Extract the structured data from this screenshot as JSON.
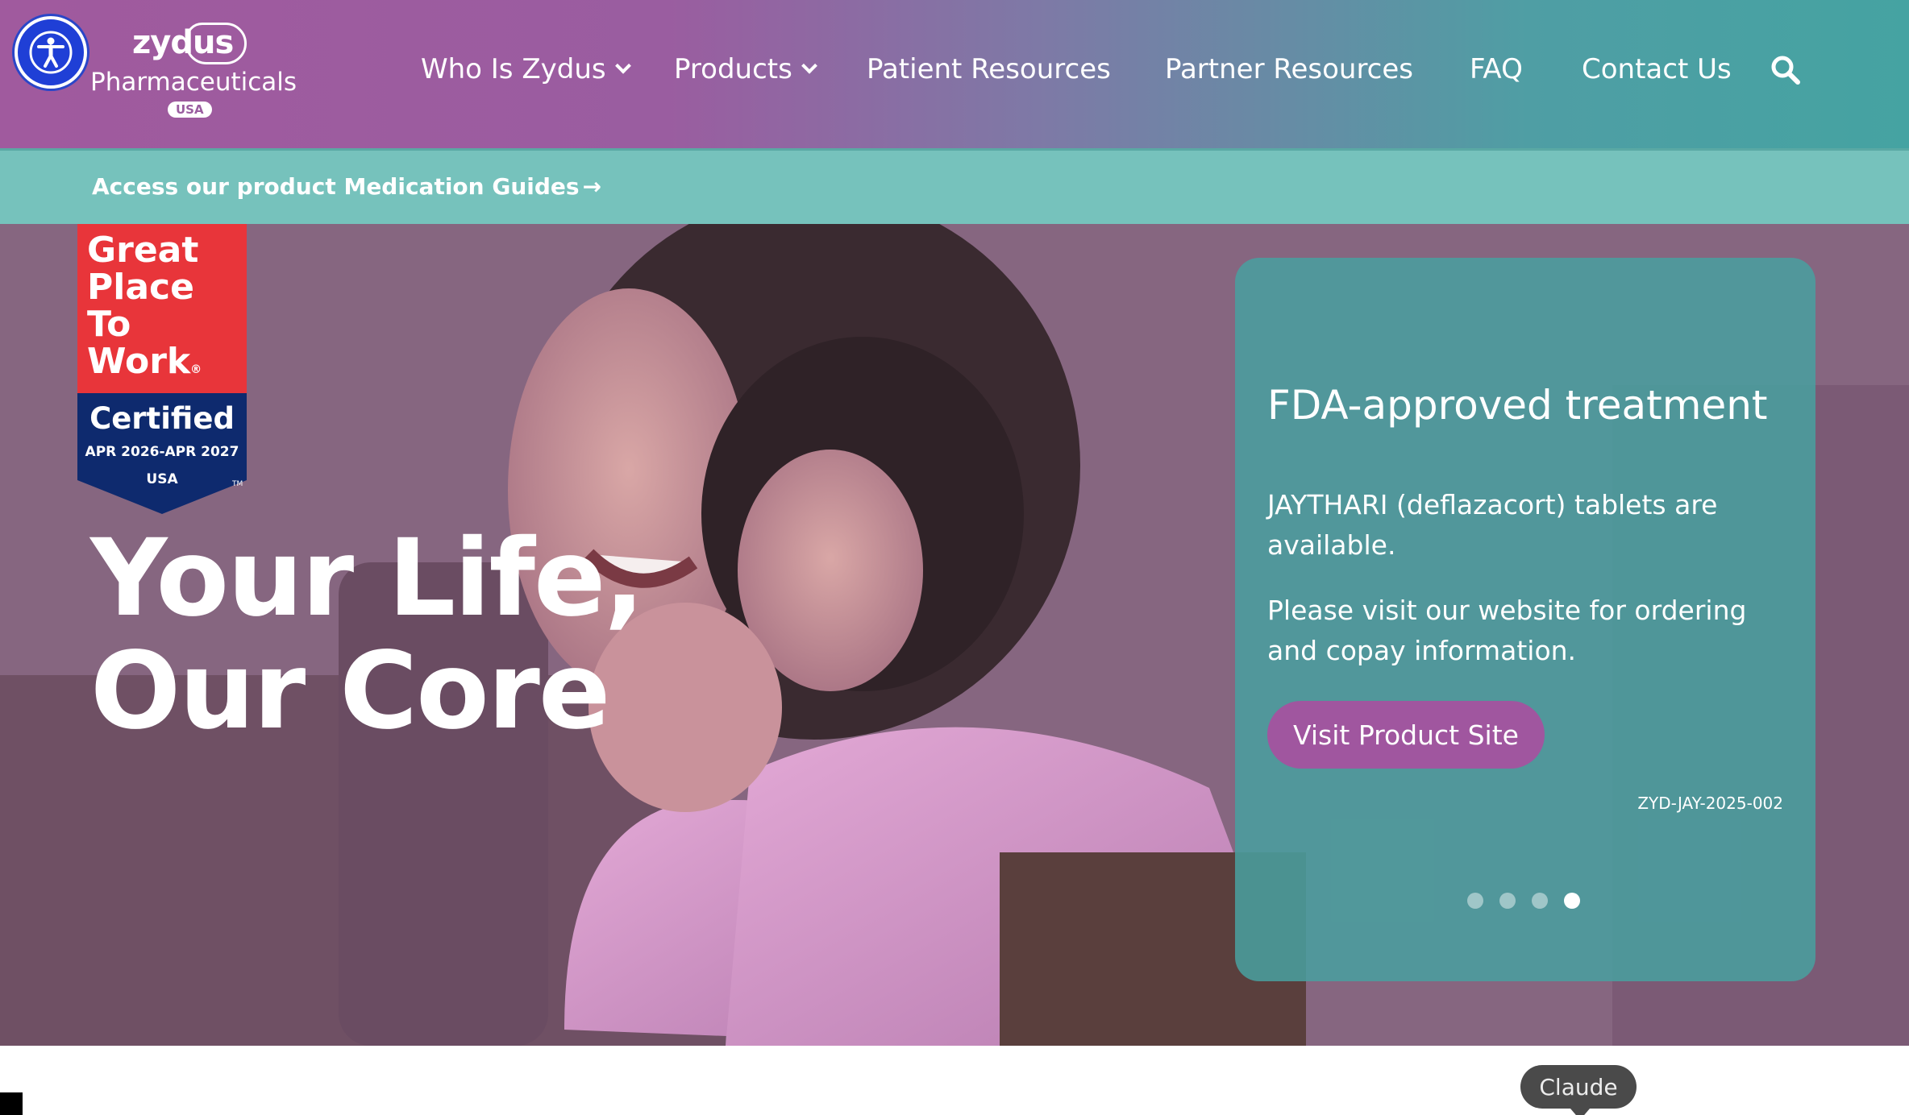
{
  "header": {
    "accessibility_icon": "accessibility-icon",
    "logo": {
      "word": "zydus",
      "subtitle": "Pharmaceuticals",
      "tag": "USA"
    },
    "nav": [
      {
        "label": "Who Is Zydus",
        "dropdown": true
      },
      {
        "label": "Products",
        "dropdown": true
      },
      {
        "label": "Patient Resources",
        "dropdown": false
      },
      {
        "label": "Partner Resources",
        "dropdown": false
      },
      {
        "label": "FAQ",
        "dropdown": false
      },
      {
        "label": "Contact Us",
        "dropdown": false
      }
    ],
    "search_icon": "search-icon"
  },
  "announcement": {
    "text": "Access our product Medication Guides",
    "arrow": "→"
  },
  "hero": {
    "badge": {
      "line1": "Great",
      "line2": "Place",
      "line3": "To",
      "line4": "Work",
      "certified": "Certified",
      "dates": "APR 2026-APR 2027",
      "country": "USA",
      "trademark": "TM",
      "registered": "®"
    },
    "headline_line1": "Your Life,",
    "headline_line2": "Our Core",
    "card": {
      "title": "FDA-approved treatment",
      "paragraph1": "JAYTHARI (deflazacort) tablets are available.",
      "paragraph2": "Please visit our website for ordering and copay information.",
      "button": "Visit Product Site",
      "code": "ZYD-JAY-2025-002",
      "slides_total": 4,
      "active_slide": 4
    }
  },
  "overlay": {
    "tooltip": "Claude"
  },
  "colors": {
    "header_left": "#a05a9e",
    "header_right": "#45a3a2",
    "announcement_bg": "#76c2bc",
    "card_bg": "#48a0a0",
    "button_bg": "#a0569f",
    "badge_red": "#e8353a",
    "badge_navy": "#0e2a6e",
    "accessibility_blue": "#1f3fd6"
  }
}
